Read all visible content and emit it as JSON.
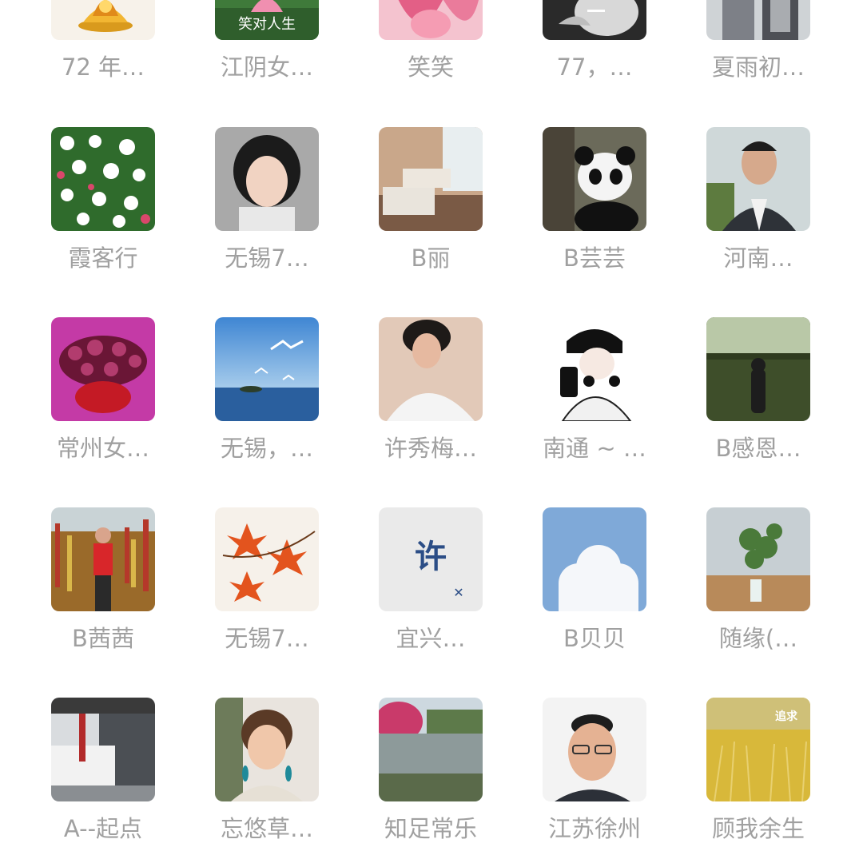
{
  "members": [
    {
      "name": "72 年…",
      "image": "golden-lotus-avatar"
    },
    {
      "name": "江阴女…",
      "image": "pink-lotus-avatar",
      "overlay_text": "笑对人生"
    },
    {
      "name": "笑笑",
      "image": "pink-petals-avatar"
    },
    {
      "name": "77，…",
      "image": "black-white-smoking-avatar"
    },
    {
      "name": "夏雨初…",
      "image": "person-avatar"
    },
    {
      "name": "霞客行",
      "image": "white-roses-avatar"
    },
    {
      "name": "无锡7…",
      "image": "woman-portrait-avatar"
    },
    {
      "name": "B丽",
      "image": "hotel-room-avatar"
    },
    {
      "name": "B芸芸",
      "image": "panda-avatar"
    },
    {
      "name": "河南…",
      "image": "man-portrait-avatar"
    },
    {
      "name": "常州女…",
      "image": "purple-flowers-avatar"
    },
    {
      "name": "无锡，…",
      "image": "seagulls-sea-avatar"
    },
    {
      "name": "许秀梅…",
      "image": "woman-selfie-avatar"
    },
    {
      "name": "南通 ~ …",
      "image": "cartoon-girl-phone-avatar"
    },
    {
      "name": "B感恩…",
      "image": "silhouette-field-avatar"
    },
    {
      "name": "B茜茜",
      "image": "woman-flower-field-avatar"
    },
    {
      "name": "无锡7…",
      "image": "maple-leaves-avatar"
    },
    {
      "name": "宜兴…",
      "image": "xu-character-avatar",
      "overlay_text": "许"
    },
    {
      "name": "B贝贝",
      "image": "cloud-sky-avatar"
    },
    {
      "name": "随缘(…",
      "image": "plant-vase-avatar"
    },
    {
      "name": "A--起点",
      "image": "building-avatar"
    },
    {
      "name": "忘悠草…",
      "image": "woman-earrings-avatar"
    },
    {
      "name": "知足常乐",
      "image": "blossom-river-avatar"
    },
    {
      "name": "江苏徐州",
      "image": "man-glasses-avatar"
    },
    {
      "name": "顾我余生",
      "image": "golden-field-avatar",
      "overlay_text": "追求"
    }
  ]
}
